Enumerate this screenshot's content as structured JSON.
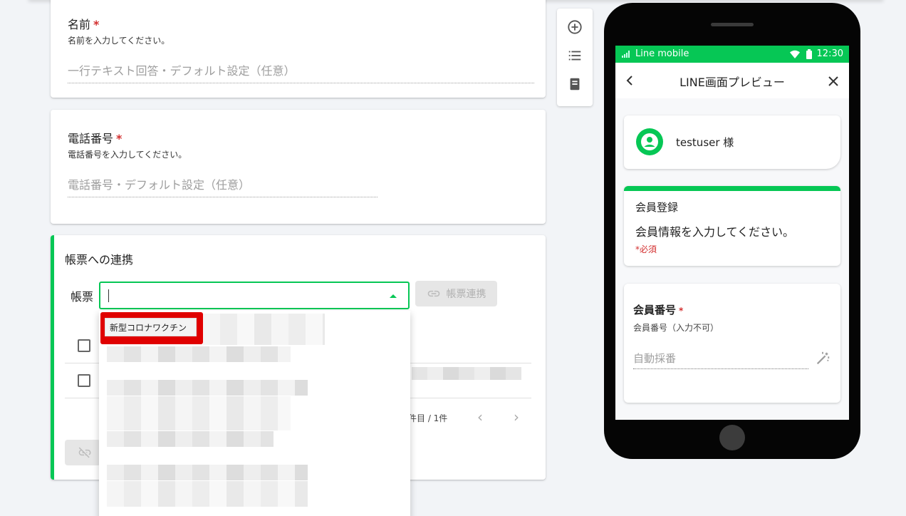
{
  "form": {
    "name_question": {
      "title": "名前",
      "required_mark": "*",
      "description": "名前を入力してください。",
      "placeholder": "一行テキスト回答・デフォルト設定（任意）"
    },
    "phone_question": {
      "title": "電話番号",
      "required_mark": "*",
      "description": "電話番号を入力してください。",
      "placeholder": "電話番号・デフォルト設定（任意）"
    },
    "ledger_link": {
      "section_title": "帳票への連携",
      "field_label": "帳票",
      "link_button": "帳票連携",
      "pager_text": "件目 / 1件",
      "dropdown_highlighted_option": "新型コロナワクチン"
    }
  },
  "toolbar": {
    "icons": [
      "add-circle-icon",
      "list-icon",
      "form-icon"
    ]
  },
  "preview": {
    "status_carrier": "Line mobile",
    "status_time": "12:30",
    "appbar_title": "LINE画面プレビュー",
    "user_name": "testuser 様",
    "form_title": "会員登録",
    "form_description": "会員情報を入力してください。",
    "required_note": "*必須",
    "question_title": "会員番号",
    "question_required_mark": "*",
    "question_description": "会員番号（入力不可）",
    "question_value": "自動採番"
  },
  "colors": {
    "accent_green": "#06c755",
    "required_red": "#d32f2f",
    "highlight_red": "#e00000"
  }
}
